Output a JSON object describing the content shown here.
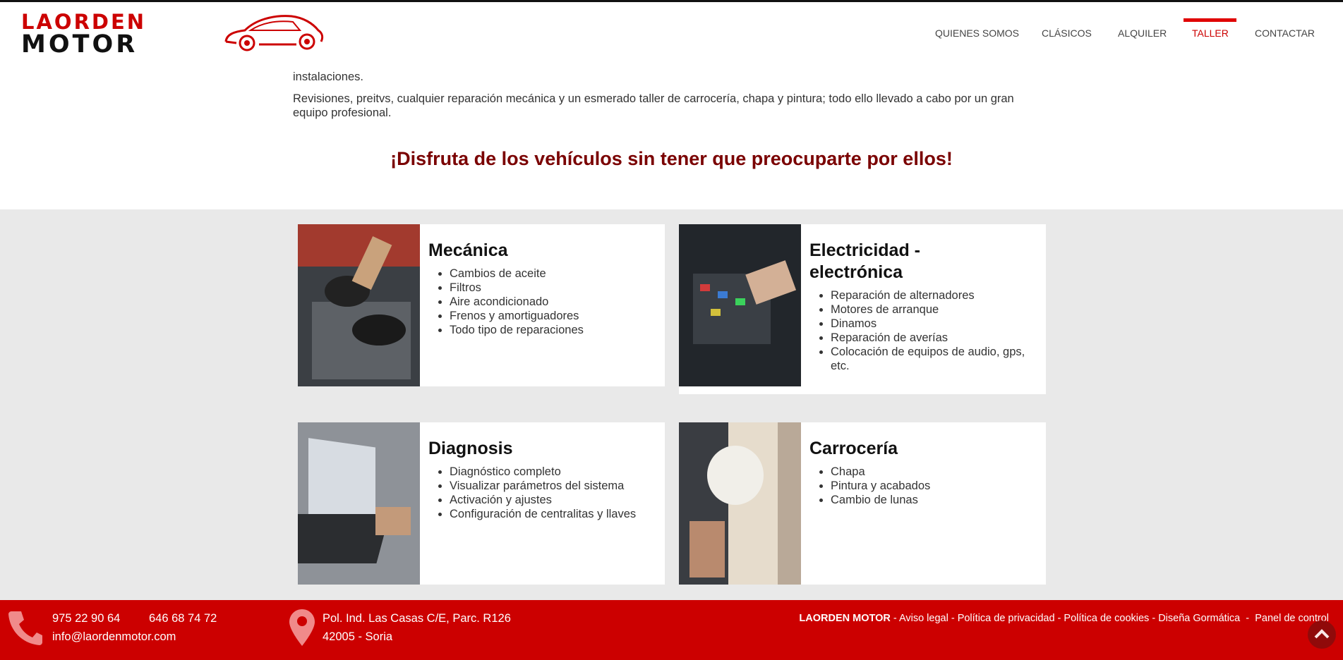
{
  "logo": {
    "line1": "LAORDEN",
    "line2": "MOTOR"
  },
  "nav": {
    "items": [
      {
        "label": "QUIENES SOMOS"
      },
      {
        "label": "CLÁSICOS"
      },
      {
        "label": "ALQUILER"
      },
      {
        "label": "TALLER",
        "active": true
      },
      {
        "label": "CONTACTAR"
      }
    ]
  },
  "intro": {
    "line1": "instalaciones.",
    "line2": "Revisiones, preitvs, cualquier reparación mecánica y un esmerado taller de carrocería, chapa y pintura; todo ello llevado a cabo por un gran equipo profesional."
  },
  "headline": "¡Disfruta de los vehículos sin tener que preocuparte por ellos!",
  "services": [
    {
      "title": "Mecánica",
      "items": [
        "Cambios de aceite",
        "Filtros",
        "Aire acondicionado",
        "Frenos y amortiguadores",
        "Todo tipo de reparaciones"
      ]
    },
    {
      "title": "Electricidad - electrónica",
      "items": [
        "Reparación de alternadores",
        "Motores de arranque",
        "Dinamos",
        "Reparación de averías",
        "Colocación de equipos de audio, gps, etc."
      ]
    },
    {
      "title": "Diagnosis",
      "items": [
        "Diagnóstico completo",
        "Visualizar parámetros del sistema",
        "Activación y ajustes",
        "Configuración de centralitas y llaves"
      ]
    },
    {
      "title": "Carrocería",
      "items": [
        "Chapa",
        "Pintura y acabados",
        "Cambio de lunas"
      ]
    }
  ],
  "footer": {
    "phone1": "975 22 90 64",
    "phone2": "646 68 74 72",
    "email": "info@laordenmotor.com",
    "address1": "Pol. Ind. Las Casas C/E, Parc. R126",
    "address2": "42005 - Soria",
    "brand": "LAORDEN MOTOR",
    "links": [
      "Aviso legal",
      "Política de privacidad",
      "Política de cookies",
      "Diseña Gormática",
      "Panel de control"
    ]
  },
  "colors": {
    "brand_red": "#cc0000",
    "headline": "#7a0000",
    "grey_band": "#e9e9e9"
  },
  "icons": {
    "phone": "phone-icon",
    "location": "map-pin-icon",
    "scroll_top": "chevron-up-icon"
  }
}
